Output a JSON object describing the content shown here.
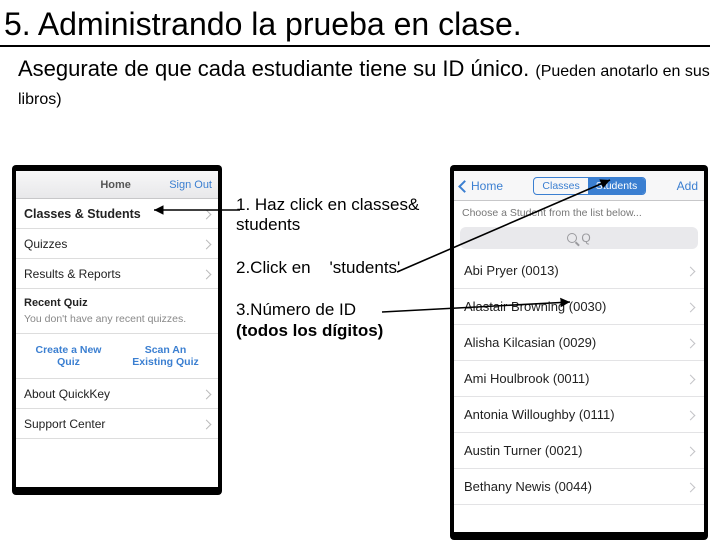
{
  "title": "5. Administrando la prueba en clase.",
  "subtitle_main": "Asegurate de que cada estudiante tiene su ID único.",
  "subtitle_note": "(Pueden anotarlo en sus libros)",
  "instructions": {
    "i1": "1. Haz click en classes& students",
    "i2a": "2.Click en",
    "i2b": "'students'",
    "i3a": "3.Número de ID",
    "i3b": "(todos los dígitos)"
  },
  "phoneA": {
    "nav_title": "Home",
    "nav_right": "Sign Out",
    "rows": {
      "classes": "Classes & Students",
      "quizzes": "Quizzes",
      "results": "Results & Reports"
    },
    "recent_label": "Recent Quiz",
    "recent_empty": "You don't have any recent quizzes.",
    "actions": {
      "create": "Create a New Quiz",
      "scan": "Scan An Existing Quiz"
    },
    "footer": {
      "about": "About QuickKey",
      "support": "Support Center"
    }
  },
  "phoneB": {
    "nav_back": "Home",
    "nav_add": "Add",
    "seg_classes": "Classes",
    "seg_students": "Students",
    "prompt": "Choose a Student from the list below...",
    "search_placeholder": "Q",
    "students": [
      "Abi Pryer (0013)",
      "Alastair Browning (0030)",
      "Alisha Kilcasian (0029)",
      "Ami Houlbrook (0011)",
      "Antonia Willoughby (0111)",
      "Austin Turner (0021)",
      "Bethany Newis (0044)"
    ]
  }
}
